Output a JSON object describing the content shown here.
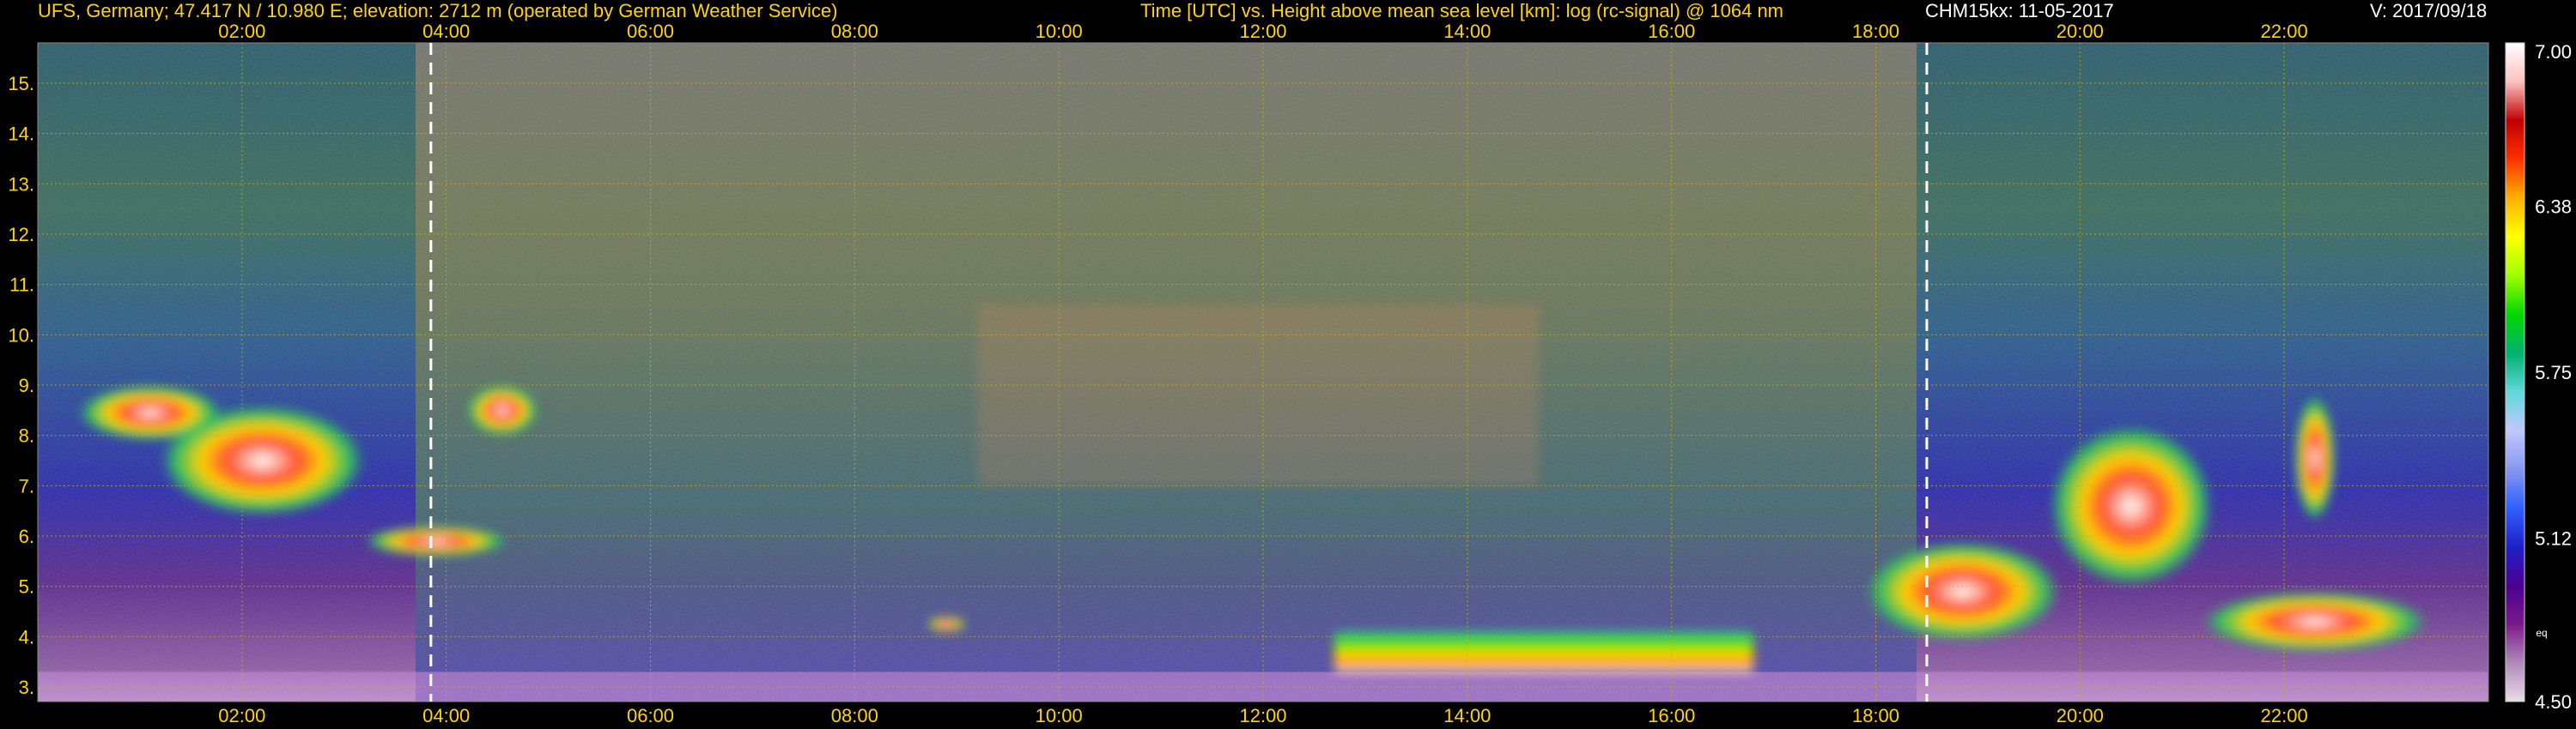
{
  "header": {
    "station": "UFS, Germany; 47.417 N / 10.980 E; elevation: 2712 m  (operated by German Weather Service)",
    "plot_title": "Time [UTC] vs. Height above mean sea level [km]: log (rc-signal) @ 1064 nm",
    "instrument_date": "CHM15kx: 11-05-2017",
    "version": "V: 2017/09/18"
  },
  "colors": {
    "background": "#000000",
    "text": "#ffd400",
    "grid": "#c8b400",
    "marker": "#ffffff"
  },
  "chart_data": {
    "type": "heatmap",
    "title": "Time [UTC] vs. Height above mean sea level [km]: log (rc-signal) @ 1064 nm",
    "xlabel": "Time [UTC]",
    "ylabel": "Height above mean sea level [km]",
    "x_range_hours": [
      0.0,
      24.0
    ],
    "y_range_km": [
      2.712,
      15.8
    ],
    "x_ticks_top": [
      "02:00",
      "04:00",
      "06:00",
      "08:00",
      "10:00",
      "12:00",
      "14:00",
      "16:00",
      "18:00",
      "20:00",
      "22:00"
    ],
    "x_ticks_bottom": [
      "02:00",
      "04:00",
      "06:00",
      "08:00",
      "10:00",
      "12:00",
      "14:00",
      "16:00",
      "18:00",
      "20:00",
      "22:00"
    ],
    "x_tick_hours": [
      2,
      4,
      6,
      8,
      10,
      12,
      14,
      16,
      18,
      20,
      22
    ],
    "y_ticks": [
      "3.",
      "4.",
      "5.",
      "6.",
      "7.",
      "8.",
      "9.",
      "10.",
      "11.",
      "12.",
      "13.",
      "14.",
      "15."
    ],
    "y_tick_values": [
      3,
      4,
      5,
      6,
      7,
      8,
      9,
      10,
      11,
      12,
      13,
      14,
      15
    ],
    "grid": true,
    "markers_hours": [
      3.85,
      18.5
    ],
    "colorbar": {
      "min": 4.5,
      "max": 7.0,
      "ticks": [
        "7.00",
        "6.38",
        "5.75",
        "5.12",
        "4.50"
      ],
      "tick_values": [
        7.0,
        6.38,
        5.75,
        5.12,
        4.5
      ],
      "unit": "eq",
      "colors": [
        "#e8dce8",
        "#b08ab8",
        "#7a1a8a",
        "#4c0090",
        "#2020c8",
        "#3060ff",
        "#8898f0",
        "#c0c8ff",
        "#60d8d8",
        "#00b070",
        "#00d800",
        "#a0ff00",
        "#ffff00",
        "#ffb000",
        "#ff3000",
        "#c00000",
        "#ffc0c0",
        "#ffffff"
      ]
    },
    "features": [
      {
        "type": "layer",
        "start_h": 12.7,
        "end_h": 16.8,
        "bottom_km": 3.3,
        "top_km": 4.1
      },
      {
        "type": "cloud",
        "start_h": 17.9,
        "end_h": 19.8,
        "bottom_km": 3.9,
        "top_km": 5.9
      },
      {
        "type": "cloud",
        "start_h": 19.7,
        "end_h": 21.3,
        "bottom_km": 5.0,
        "top_km": 8.2
      },
      {
        "type": "cloud",
        "start_h": 21.2,
        "end_h": 23.4,
        "bottom_km": 3.7,
        "top_km": 4.9
      },
      {
        "type": "cloud",
        "start_h": 1.2,
        "end_h": 3.2,
        "bottom_km": 6.4,
        "top_km": 8.6
      },
      {
        "type": "cloud",
        "start_h": 3.2,
        "end_h": 4.6,
        "bottom_km": 5.6,
        "top_km": 6.2
      },
      {
        "type": "cloud",
        "start_h": 4.2,
        "end_h": 4.9,
        "bottom_km": 8.0,
        "top_km": 9.0
      },
      {
        "type": "cloud",
        "start_h": 8.7,
        "end_h": 9.1,
        "bottom_km": 4.1,
        "top_km": 4.4
      },
      {
        "type": "cloud",
        "start_h": 0.4,
        "end_h": 1.8,
        "bottom_km": 7.9,
        "top_km": 9.0
      },
      {
        "type": "cloud",
        "start_h": 22.1,
        "end_h": 22.5,
        "bottom_km": 6.3,
        "top_km": 8.8
      },
      {
        "type": "cirrus",
        "start_h": 9.2,
        "end_h": 14.7,
        "bottom_km": 7.0,
        "top_km": 10.6
      }
    ]
  }
}
